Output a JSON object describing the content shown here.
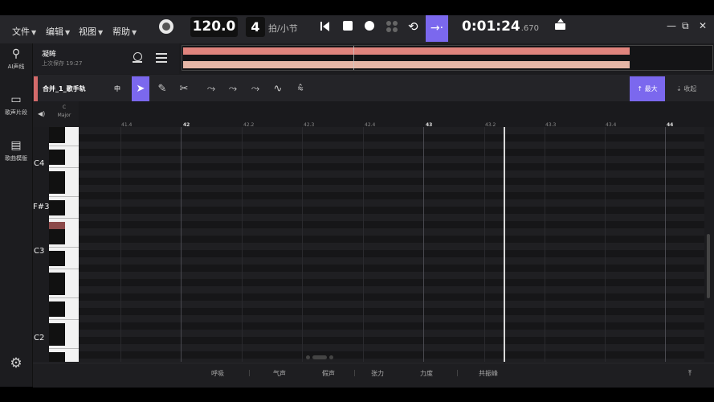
{
  "menu": [
    {
      "label": "文件"
    },
    {
      "label": "编辑"
    },
    {
      "label": "视图"
    },
    {
      "label": "帮助"
    }
  ],
  "transport": {
    "tempo": "120.0",
    "beats": "4",
    "beats_unit": "拍/小节",
    "time_main": "0:01:24",
    "time_ms": ".670",
    "follow_glyph": "→·"
  },
  "window_controls": [
    "—",
    "⧉",
    "✕"
  ],
  "sidebar": [
    {
      "label": "AI声线",
      "icon": "ai-voice-icon"
    },
    {
      "label": "歌声片段",
      "icon": "vocal-clip-icon"
    },
    {
      "label": "歌曲模版",
      "icon": "song-template-icon"
    }
  ],
  "project": {
    "name": "凝眸",
    "saved": "上次保存 19:27"
  },
  "track": {
    "name": "合并_1_歌手轨",
    "pitch": "中"
  },
  "tools": [
    {
      "name": "select-tool",
      "glyph": "➤",
      "active": true
    },
    {
      "name": "pencil-tool",
      "glyph": "✎",
      "active": false
    },
    {
      "name": "scissors-tool",
      "glyph": "✂",
      "active": false
    },
    {
      "name": "pitch-curve-tool",
      "glyph": "⤳",
      "active": false
    },
    {
      "name": "pitch-erase-tool",
      "glyph": "⤳",
      "active": false
    },
    {
      "name": "pitch-smooth-tool",
      "glyph": "⤳",
      "active": false
    },
    {
      "name": "vibrato-tool",
      "glyph": "∿",
      "active": false
    },
    {
      "name": "wave-tool",
      "glyph": "⩯",
      "active": false
    }
  ],
  "view": {
    "max_label": "最大",
    "collapse_label": "收起"
  },
  "key_signature": {
    "root": "C",
    "mode": "Major"
  },
  "ruler": [
    {
      "label": "41.4"
    },
    {
      "label": "42"
    },
    {
      "label": "42.2"
    },
    {
      "label": "42.3"
    },
    {
      "label": "42.4"
    },
    {
      "label": "43"
    },
    {
      "label": "43.2"
    },
    {
      "label": "43.3"
    },
    {
      "label": "43.4"
    },
    {
      "label": "44"
    }
  ],
  "note_labels": {
    "c4": "C4",
    "fs3": "F#3",
    "c3": "C3",
    "c2": "C2"
  },
  "params": [
    "呼吸",
    "气声",
    "假声",
    "张力",
    "力度",
    "共振峰"
  ],
  "colors": {
    "accent": "#7b68ee",
    "track": "#d36a6a",
    "clip_a": "#e0847d",
    "clip_b": "#e6b6a6"
  }
}
